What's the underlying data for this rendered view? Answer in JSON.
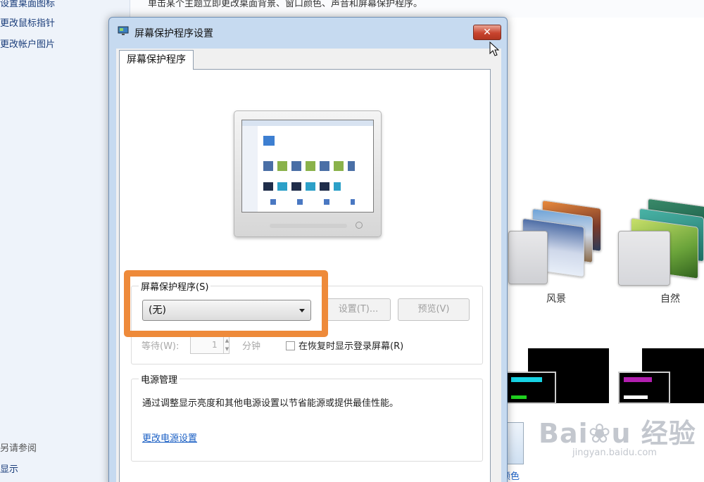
{
  "background": {
    "sidebar_links": [
      "设置桌面图标",
      "更改鼠标指针",
      "更改帐户图片"
    ],
    "sidebar_footer": [
      "另请参阅",
      "显示"
    ],
    "description": "单击某个主题立即更改桌面背景、窗口颜色、声音和屏幕保护程序。",
    "themes": [
      {
        "label": "风景"
      },
      {
        "label": "自然"
      }
    ],
    "partial_label": "颜色",
    "watermark": {
      "logo": "Bai 经验",
      "site": "jingyan.baidu.com"
    }
  },
  "dialog": {
    "title": "屏幕保护程序设置",
    "close_symbol": "✕",
    "tab_label": "屏幕保护程序",
    "screensaver_group_label": "屏幕保护程序(S)",
    "screensaver_value": "(无)",
    "settings_button": "设置(T)...",
    "preview_button": "预览(V)",
    "wait_label": "等待(W):",
    "wait_value": "1",
    "wait_unit": "分钟",
    "resume_label": "在恢复时显示登录屏幕(R)",
    "power_group_label": "电源管理",
    "power_description": "通过调整显示亮度和其他电源设置以节省能源或提供最佳性能。",
    "power_link": "更改电源设置"
  },
  "colors": {
    "highlight": "#ee8a3a",
    "link": "#1a5fc4",
    "close_button": "#c8442e"
  }
}
